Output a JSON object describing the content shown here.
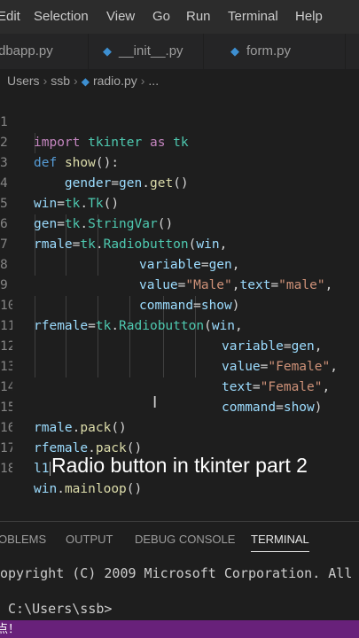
{
  "menubar": {
    "items": [
      "Edit",
      "Selection",
      "View",
      "Go",
      "Run",
      "Terminal",
      "Help"
    ]
  },
  "tabs": [
    {
      "label": "dbapp.py"
    },
    {
      "label": "__init__.py"
    },
    {
      "label": "form.py"
    }
  ],
  "breadcrumb": {
    "parts": [
      "Users",
      "ssb",
      "radio.py"
    ],
    "trailing": "..."
  },
  "editor": {
    "line_numbers": [
      "1",
      "2",
      "3",
      "4",
      "5",
      "6",
      "7",
      "8",
      "9",
      "10",
      "11",
      "12",
      "13",
      "14",
      "15",
      "16",
      "17",
      "18"
    ],
    "lines": {
      "l1": {
        "a": "import",
        "b": " tkinter ",
        "c": "as",
        "d": " tk"
      },
      "l2": {
        "a": "def",
        "b": " ",
        "c": "show",
        "d": "():"
      },
      "l3": {
        "a": "    gender",
        "b": "=",
        "c": "gen",
        "d": ".",
        "e": "get",
        "f": "()"
      },
      "l4": {
        "a": "win",
        "b": "=",
        "c": "tk",
        "d": ".",
        "e": "Tk",
        "f": "()"
      },
      "l5": {
        "a": "gen",
        "b": "=",
        "c": "tk",
        "d": ".",
        "e": "StringVar",
        "f": "()"
      },
      "l6": {
        "a": "rmale",
        "b": "=",
        "c": "tk",
        "d": ".",
        "e": "Radiobutton",
        "f": "(",
        "g": "win",
        "h": ","
      },
      "l7": {
        "a": "variable",
        "b": "=",
        "c": "gen",
        "d": ","
      },
      "l8": {
        "a": "value",
        "b": "=",
        "c": "\"Male\"",
        "d": ",",
        "e": "text",
        "f": "=",
        "g": "\"male\"",
        "h": ","
      },
      "l9": {
        "a": "command",
        "b": "=",
        "c": "show",
        "d": ")"
      },
      "l10": {
        "a": "rfemale",
        "b": "=",
        "c": "tk",
        "d": ".",
        "e": "Radiobutton",
        "f": "(",
        "g": "win",
        "h": ","
      },
      "l11": {
        "a": "variable",
        "b": "=",
        "c": "gen",
        "d": ","
      },
      "l12": {
        "a": "value",
        "b": "=",
        "c": "\"Female\"",
        "d": ","
      },
      "l13": {
        "a": "text",
        "b": "=",
        "c": "\"Female\"",
        "d": ","
      },
      "l14": {
        "a": "command",
        "b": "=",
        "c": "show",
        "d": ")"
      },
      "l15": {
        "a": "rmale",
        "b": ".",
        "c": "pack",
        "d": "()"
      },
      "l16": {
        "a": "rfemale",
        "b": ".",
        "c": "pack",
        "d": "()"
      },
      "l17": {
        "a": "l1"
      },
      "l18": {
        "a": "win",
        "b": ".",
        "c": "mainloop",
        "d": "()"
      }
    }
  },
  "caption": "Radio button in tkinter part 2",
  "panel": {
    "tabs": [
      "OBLEMS",
      "OUTPUT",
      "DEBUG CONSOLE",
      "TERMINAL"
    ]
  },
  "terminal": {
    "line1": "opyright (C) 2009 Microsoft Corporation. All ri",
    "line2": " C:\\Users\\ssb>"
  },
  "statusbar": {
    "text": "点！"
  },
  "colors": {
    "accent": "#68217a",
    "keyword": "#569cd6",
    "string": "#ce9178",
    "function": "#dcdcaa"
  }
}
